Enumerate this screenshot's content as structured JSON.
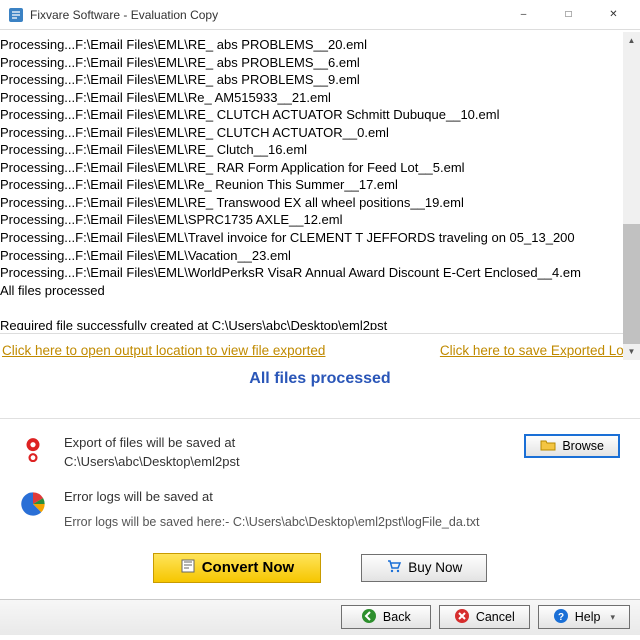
{
  "window": {
    "title": "Fixvare Software - Evaluation Copy"
  },
  "log": {
    "lines": [
      "Processing...F:\\Email Files\\EML\\RE_ abs PROBLEMS__20.eml",
      "Processing...F:\\Email Files\\EML\\RE_ abs PROBLEMS__6.eml",
      "Processing...F:\\Email Files\\EML\\RE_ abs PROBLEMS__9.eml",
      "Processing...F:\\Email Files\\EML\\Re_ AM515933__21.eml",
      "Processing...F:\\Email Files\\EML\\RE_ CLUTCH ACTUATOR Schmitt Dubuque__10.eml",
      "Processing...F:\\Email Files\\EML\\RE_ CLUTCH ACTUATOR__0.eml",
      "Processing...F:\\Email Files\\EML\\RE_ Clutch__16.eml",
      "Processing...F:\\Email Files\\EML\\RE_ RAR Form Application for Feed Lot__5.eml",
      "Processing...F:\\Email Files\\EML\\Re_ Reunion This Summer__17.eml",
      "Processing...F:\\Email Files\\EML\\RE_ Transwood EX all wheel positions__19.eml",
      "Processing...F:\\Email Files\\EML\\SPRC1735 AXLE__12.eml",
      "Processing...F:\\Email Files\\EML\\Travel invoice for CLEMENT T JEFFORDS traveling on 05_13_200",
      "Processing...F:\\Email Files\\EML\\Vacation__23.eml",
      "Processing...F:\\Email Files\\EML\\WorldPerksR VisaR Annual Award Discount E-Cert Enclosed__4.em",
      "All files processed",
      "",
      "Required file successfully created at C:\\Users\\abc\\Desktop\\eml2pst"
    ]
  },
  "links": {
    "open_output": "Click here to open output location to view file exported",
    "save_logs": "Click here to save Exported Logs"
  },
  "status": "All files processed",
  "export_panel": {
    "label": "Export of files will be saved at",
    "path": "C:\\Users\\abc\\Desktop\\eml2pst",
    "browse": "Browse"
  },
  "log_panel": {
    "label": "Error logs will be saved at",
    "detail": "Error logs will be saved here:- C:\\Users\\abc\\Desktop\\eml2pst\\logFile_da.txt"
  },
  "actions": {
    "convert": "Convert Now",
    "buy": "Buy Now"
  },
  "footer": {
    "back": "Back",
    "cancel": "Cancel",
    "help": "Help"
  }
}
